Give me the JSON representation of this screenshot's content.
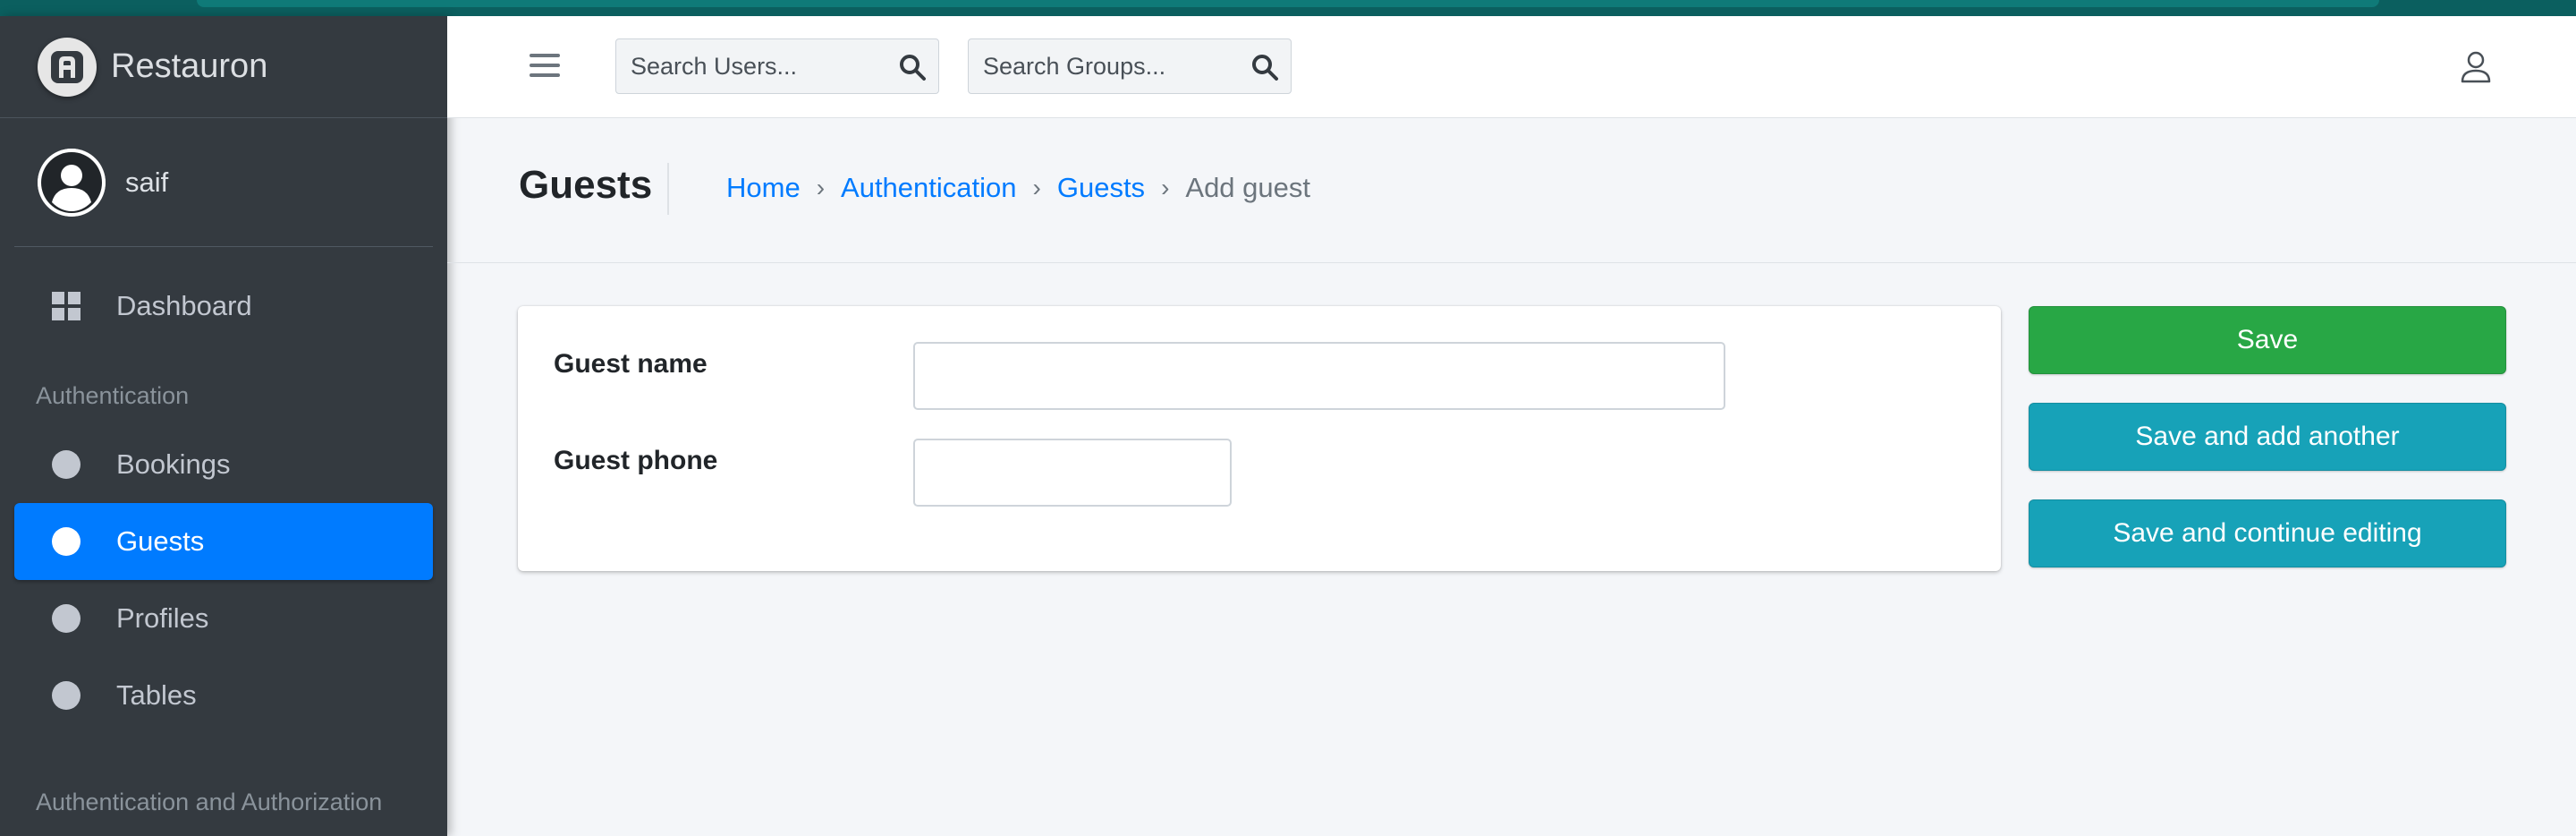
{
  "brand": {
    "name": "Restauron"
  },
  "user": {
    "name": "saif"
  },
  "sidebar": {
    "dashboard": "Dashboard",
    "section1": "Authentication",
    "items": [
      {
        "label": "Bookings",
        "active": false
      },
      {
        "label": "Guests",
        "active": true
      },
      {
        "label": "Profiles",
        "active": false
      },
      {
        "label": "Tables",
        "active": false
      }
    ],
    "section2": "Authentication and Authorization"
  },
  "navbar": {
    "search_users_placeholder": "Search Users...",
    "search_groups_placeholder": "Search Groups..."
  },
  "header": {
    "title": "Guests",
    "breadcrumb": [
      "Home",
      "Authentication",
      "Guests"
    ],
    "breadcrumb_current": "Add guest"
  },
  "form": {
    "fields": [
      {
        "label": "Guest name",
        "value": ""
      },
      {
        "label": "Guest phone",
        "value": ""
      }
    ]
  },
  "actions": {
    "save": "Save",
    "save_add": "Save and add another",
    "save_continue": "Save and continue editing"
  },
  "colors": {
    "sidebar_bg": "#343a40",
    "active": "#007bff",
    "save": "#28a745",
    "info": "#17a2b8"
  }
}
